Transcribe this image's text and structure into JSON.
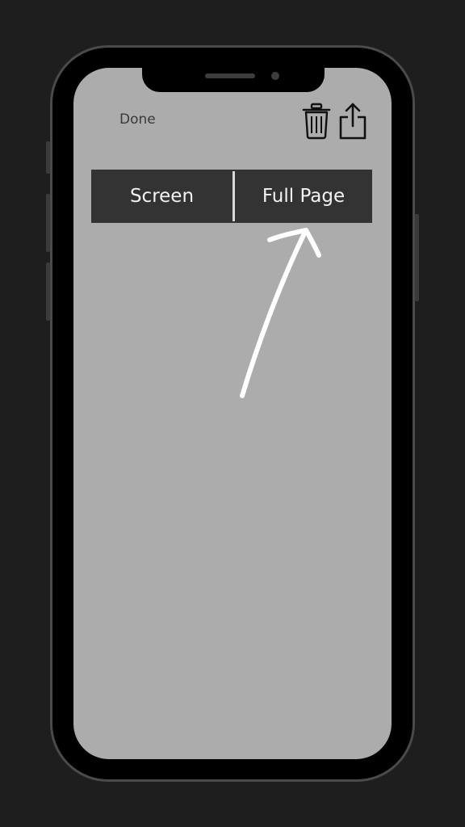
{
  "toolbar": {
    "done_label": "Done",
    "trash_icon": "trash-icon",
    "share_icon": "share-icon"
  },
  "segmented_control": {
    "segments": [
      {
        "label": "Screen"
      },
      {
        "label": "Full Page"
      }
    ]
  },
  "colors": {
    "background": "#1e1e1e",
    "screen": "#acacac",
    "segment_bg": "#333333",
    "segment_text": "#f2f2f2",
    "annotation": "#ffffff"
  }
}
